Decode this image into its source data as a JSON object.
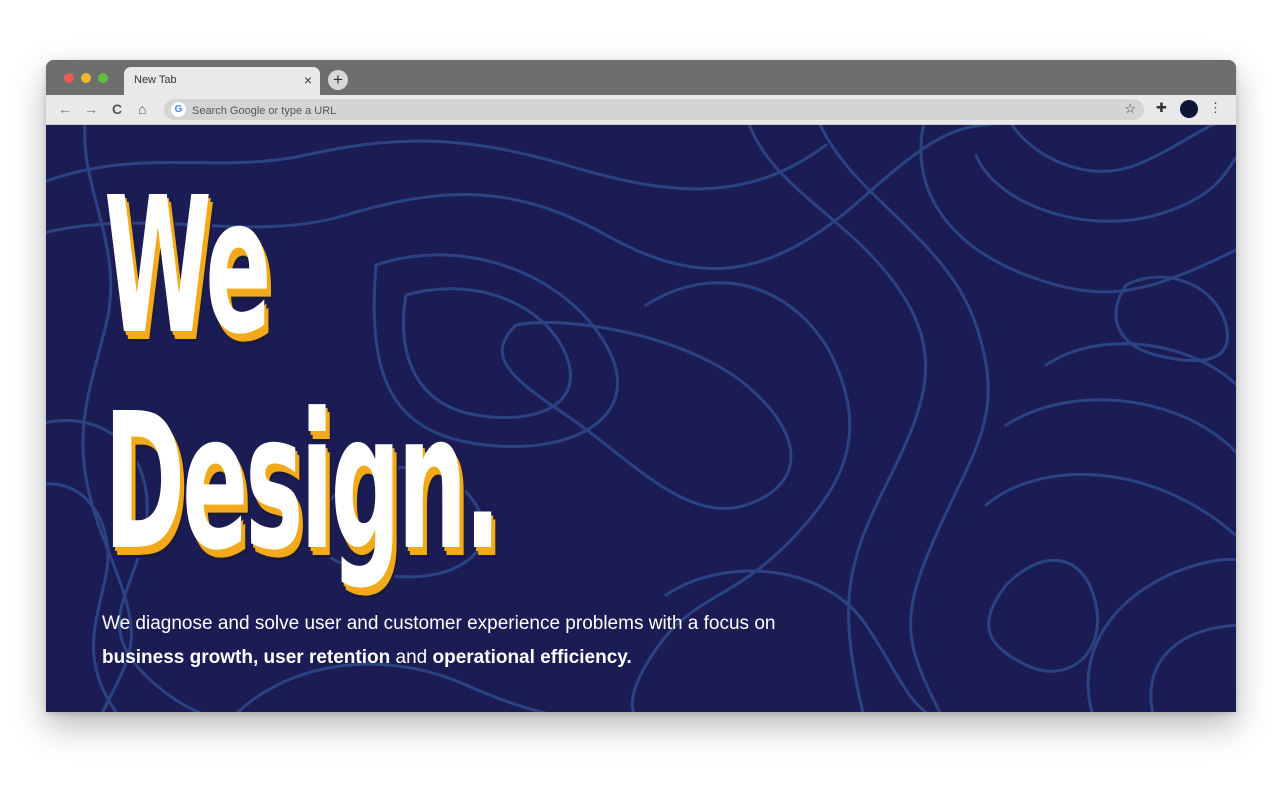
{
  "browser": {
    "tab_title": "New Tab",
    "tab_close": "×",
    "new_tab": "+",
    "nav": {
      "back": "←",
      "forward": "→",
      "reload": "C",
      "home": "⌂"
    },
    "omnibox": {
      "placeholder": "Search Google or type a URL",
      "value": ""
    },
    "icons": [
      "back-arrow-icon",
      "forward-arrow-icon",
      "reload-icon",
      "home-icon",
      "google-icon",
      "star-icon",
      "puzzle-icon",
      "avatar",
      "kebab-menu-icon"
    ]
  },
  "hero": {
    "headline_line1": "We",
    "headline_line2": "Design.",
    "description": {
      "part1": "We diagnose and solve user and customer experience problems with a focus on",
      "bold1": "business growth,",
      "bold2": "user retention",
      "part2": "and",
      "bold3": "operational efficiency",
      "end": "."
    }
  },
  "colors": {
    "background": "#1c1c54",
    "contour_lines": "#2b4382",
    "headline_text": "#ffffff",
    "headline_shadow": "#f2a91a",
    "tabbar": "#6e6e6e",
    "toolbar": "#e9e9e9"
  }
}
